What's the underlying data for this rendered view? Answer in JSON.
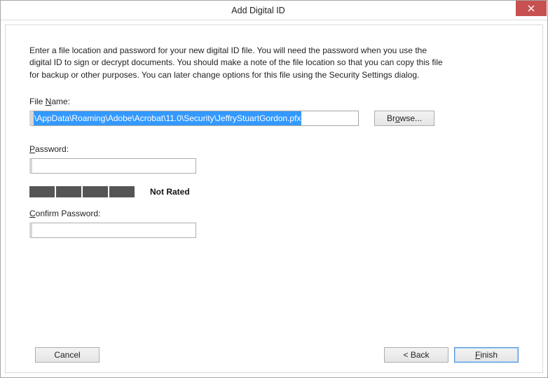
{
  "window": {
    "title": "Add Digital ID"
  },
  "instructions": "Enter a file location and password for your new digital ID file. You will need the password when you use the digital ID to sign or decrypt documents. You should make a note of the file location so that you can copy this file for backup or other purposes. You can later change options for this file using the Security Settings dialog.",
  "file": {
    "label_pre": "File ",
    "label_ul": "N",
    "label_post": "ame:",
    "value": "\\AppData\\Roaming\\Adobe\\Acrobat\\11.0\\Security\\JeffryStuartGordon.pfx",
    "browse_pre": "Br",
    "browse_ul": "o",
    "browse_post": "wse..."
  },
  "password": {
    "label_ul": "P",
    "label_post": "assword:",
    "value": "",
    "strength_label": "Not Rated"
  },
  "confirm": {
    "label_ul": "C",
    "label_post": "onfirm Password:",
    "value": ""
  },
  "buttons": {
    "cancel": "Cancel",
    "back": "<  Back",
    "finish_ul": "F",
    "finish_post": "inish"
  }
}
